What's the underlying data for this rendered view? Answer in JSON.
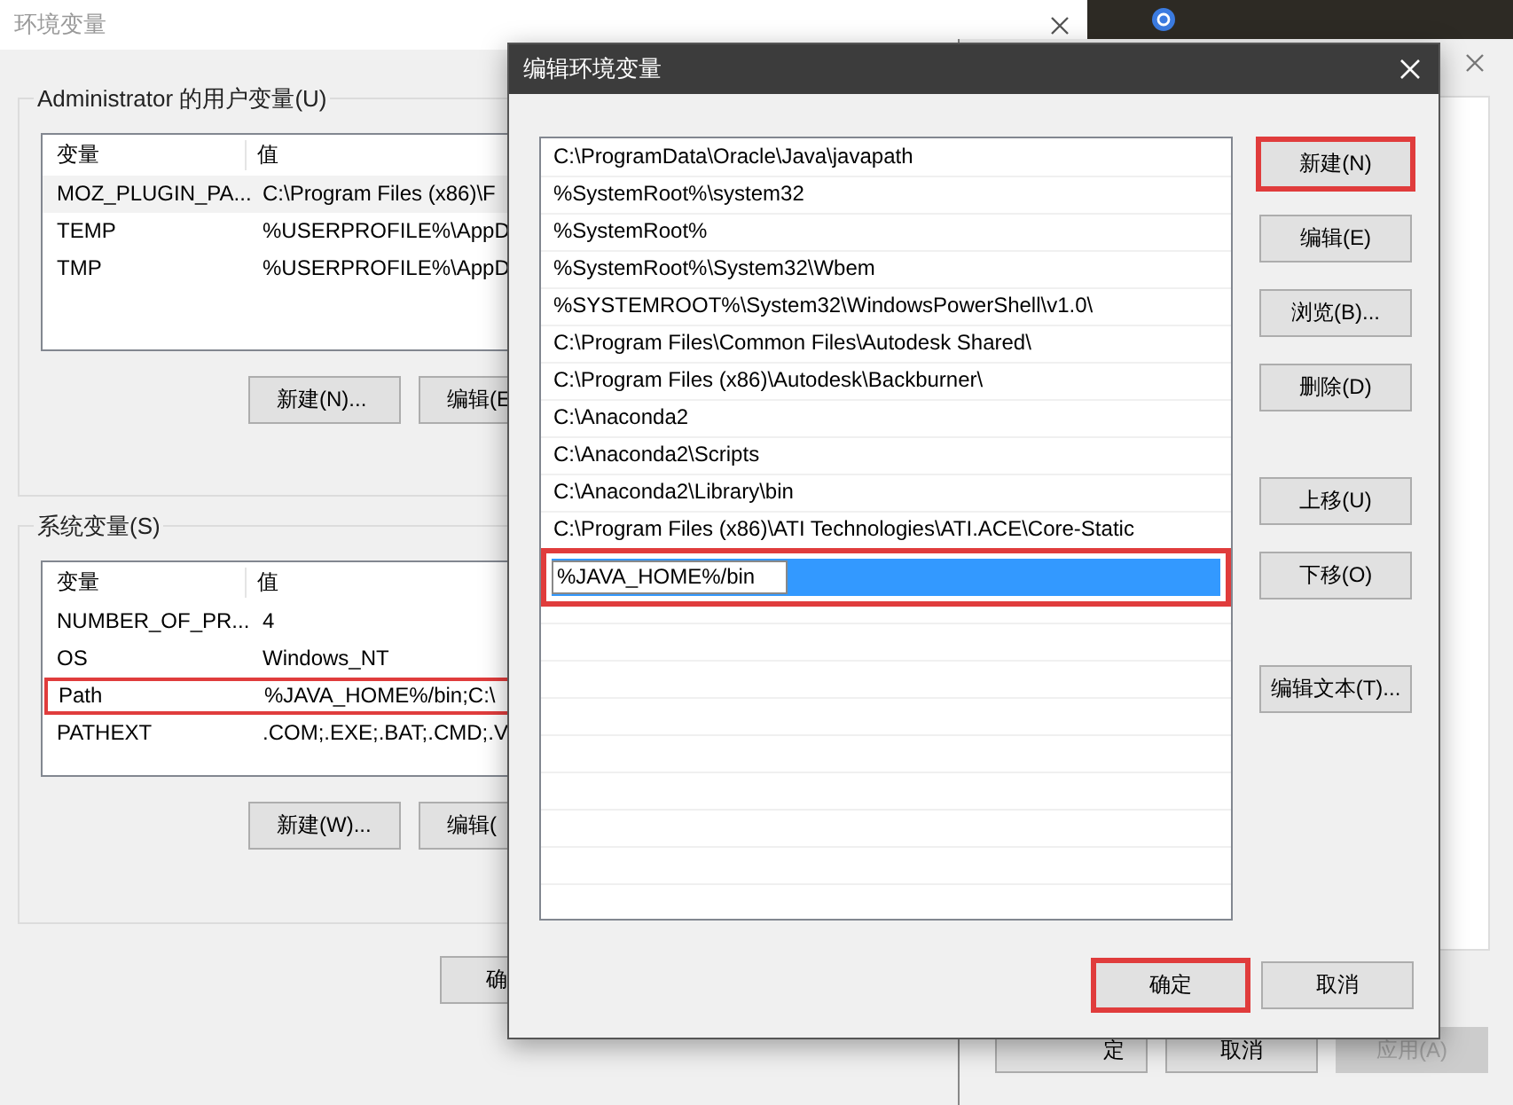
{
  "back_window": {
    "title": "环境变量",
    "user_vars": {
      "label": "Administrator 的用户变量(U)",
      "columns": [
        "变量",
        "值"
      ],
      "rows": [
        {
          "name": "MOZ_PLUGIN_PA...",
          "value": "C:\\Program Files (x86)\\F",
          "selected": true,
          "highlighted": false
        },
        {
          "name": "TEMP",
          "value": "%USERPROFILE%\\AppD",
          "selected": false,
          "highlighted": false
        },
        {
          "name": "TMP",
          "value": "%USERPROFILE%\\AppD",
          "selected": false,
          "highlighted": false
        }
      ],
      "buttons": [
        "新建(N)...",
        "编辑(E"
      ]
    },
    "system_vars": {
      "label": "系统变量(S)",
      "columns": [
        "变量",
        "值"
      ],
      "rows": [
        {
          "name": "NUMBER_OF_PR...",
          "value": "4",
          "selected": false,
          "highlighted": false
        },
        {
          "name": "OS",
          "value": "Windows_NT",
          "selected": false,
          "highlighted": false
        },
        {
          "name": "Path",
          "value": "%JAVA_HOME%/bin;C:\\",
          "selected": false,
          "highlighted": true
        },
        {
          "name": "PATHEXT",
          "value": ".COM;.EXE;.BAT;.CMD;.V",
          "selected": false,
          "highlighted": false
        }
      ],
      "buttons": [
        "新建(W)...",
        "编辑("
      ]
    },
    "ok_button": "确"
  },
  "right_window": {
    "buttons": [
      {
        "label": "定",
        "disabled": false
      },
      {
        "label": "取消",
        "disabled": false
      },
      {
        "label": "应用(A)",
        "disabled": true
      }
    ]
  },
  "dialog": {
    "title": "编辑环境变量",
    "entries": [
      "C:\\ProgramData\\Oracle\\Java\\javapath",
      "%SystemRoot%\\system32",
      "%SystemRoot%",
      "%SystemRoot%\\System32\\Wbem",
      "%SYSTEMROOT%\\System32\\WindowsPowerShell\\v1.0\\",
      "C:\\Program Files\\Common Files\\Autodesk Shared\\",
      "C:\\Program Files (x86)\\Autodesk\\Backburner\\",
      "C:\\Anaconda2",
      "C:\\Anaconda2\\Scripts",
      "C:\\Anaconda2\\Library\\bin",
      "C:\\Program Files (x86)\\ATI Technologies\\ATI.ACE\\Core-Static"
    ],
    "new_entry": {
      "value": "%JAVA_HOME%/bin",
      "highlighted": true
    },
    "button_groups": [
      [
        {
          "label": "新建(N)",
          "highlighted": true
        },
        {
          "label": "编辑(E)",
          "highlighted": false
        },
        {
          "label": "浏览(B)...",
          "highlighted": false
        },
        {
          "label": "删除(D)",
          "highlighted": false
        }
      ],
      [
        {
          "label": "上移(U)",
          "highlighted": false
        },
        {
          "label": "下移(O)",
          "highlighted": false
        }
      ],
      [
        {
          "label": "编辑文本(T)...",
          "highlighted": false
        }
      ]
    ],
    "footer_buttons": [
      {
        "label": "确定",
        "highlighted": true
      },
      {
        "label": "取消",
        "highlighted": false
      }
    ]
  }
}
